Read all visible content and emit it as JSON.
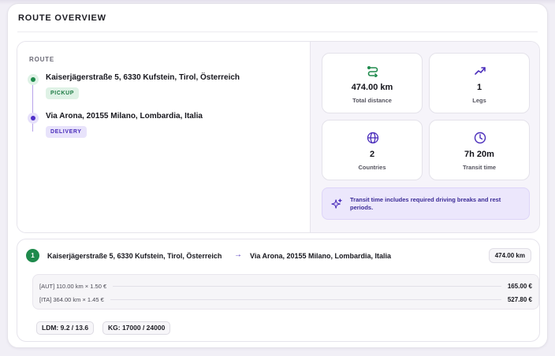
{
  "colors": {
    "pickup": "#1f8a4c",
    "delivery": "#4f2fc8",
    "accent_purple": "#4a2dbb",
    "note_bg": "#ece7fc"
  },
  "page_title": "ROUTE OVERVIEW",
  "route": {
    "label": "ROUTE",
    "stops": [
      {
        "address": "Kaiserjägerstraße 5, 6330 Kufstein, Tirol, Österreich",
        "badge": "PICKUP",
        "icon": "pickup-dot"
      },
      {
        "address": "Via Arona, 20155 Milano, Lombardia, Italia",
        "badge": "DELIVERY",
        "icon": "delivery-dot"
      }
    ]
  },
  "stats": [
    {
      "icon": "route-icon",
      "value": "474.00 km",
      "label": "Total distance"
    },
    {
      "icon": "trend-up-icon",
      "value": "1",
      "label": "Legs"
    },
    {
      "icon": "globe-icon",
      "value": "2",
      "label": "Countries"
    },
    {
      "icon": "clock-icon",
      "value": "7h 20m",
      "label": "Transit time"
    }
  ],
  "note": {
    "icon": "sparkle-icon",
    "text": "Transit time includes required driving breaks and rest periods."
  },
  "legs": [
    {
      "number": "1",
      "from": "Kaiserjägerstraße 5, 6330 Kufstein, Tirol, Österreich",
      "arrow": "→",
      "to": "Via Arona, 20155 Milano, Lombardia, Italia",
      "distance": "474.00 km",
      "costs": [
        {
          "desc": "[AUT] 110.00 km × 1.50 €",
          "amount": "165.00 €"
        },
        {
          "desc": "[ITA] 364.00 km × 1.45 €",
          "amount": "527.80 €"
        }
      ],
      "ldm": "LDM: 9.2 / 13.6",
      "kg": "KG: 17000 / 24000"
    }
  ]
}
